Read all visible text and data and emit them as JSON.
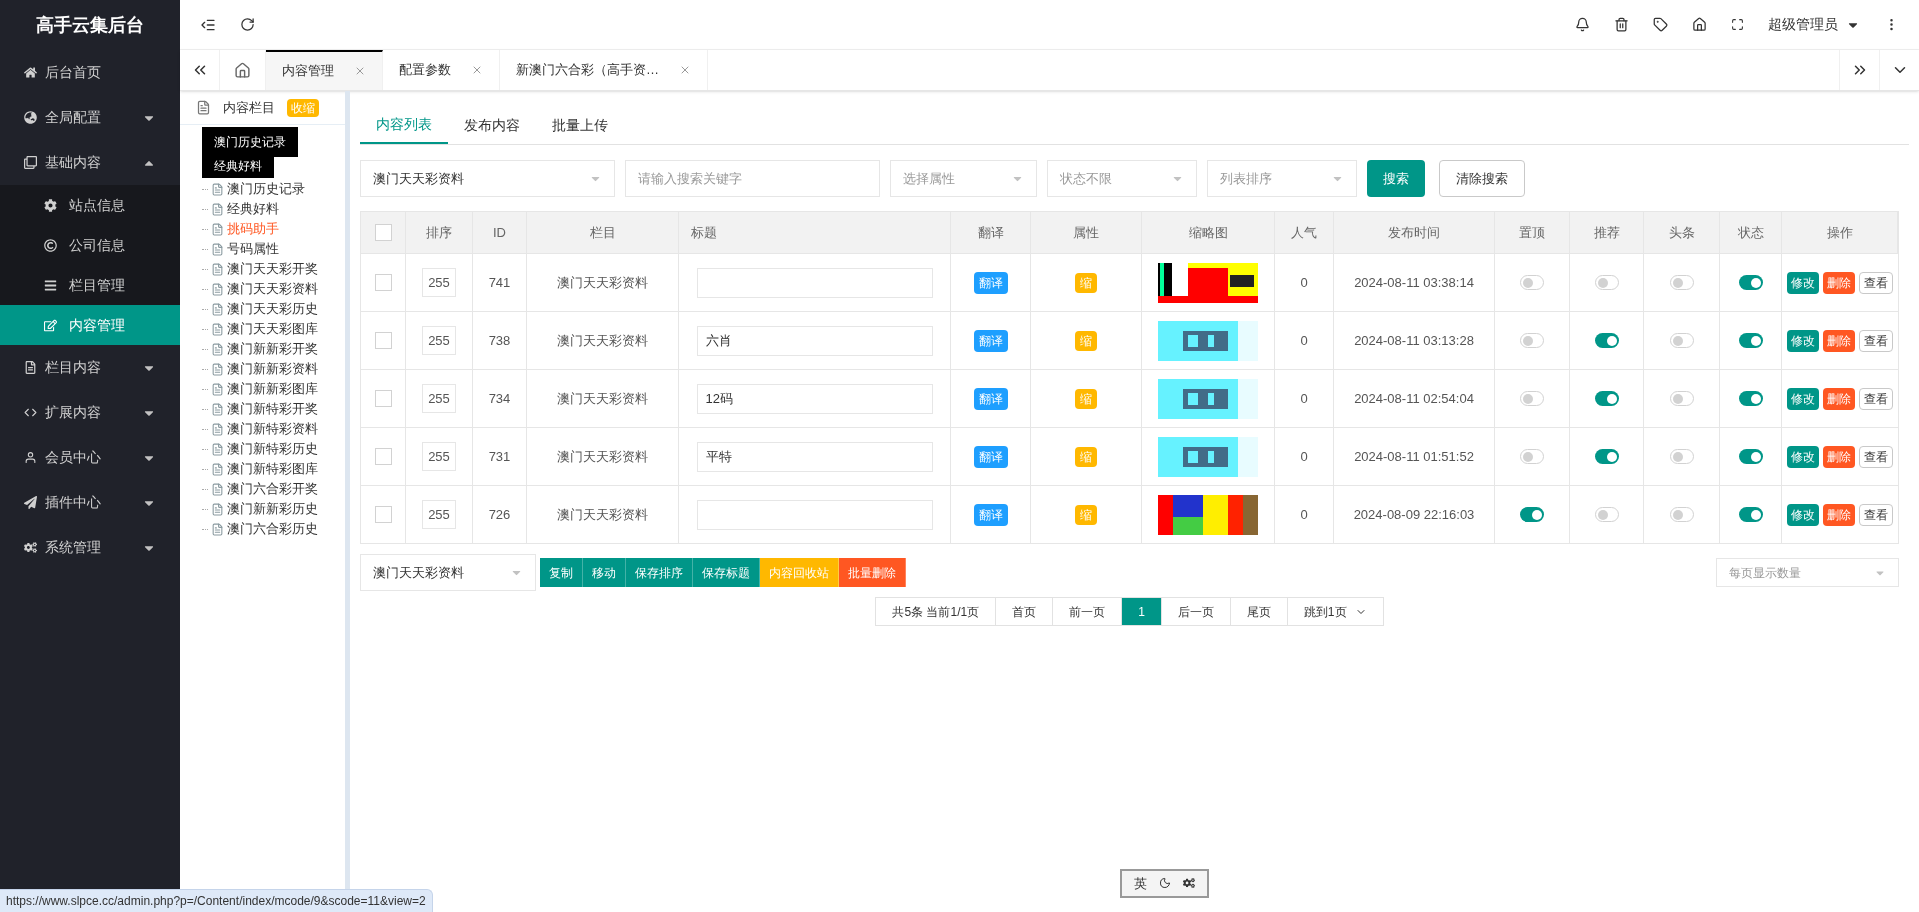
{
  "sidebar": {
    "title": "高手云集后台",
    "items": [
      {
        "label": "后台首页"
      },
      {
        "label": "全局配置",
        "expanded": false
      },
      {
        "label": "基础内容",
        "expanded": true,
        "children": [
          {
            "label": "站点信息",
            "selected": false
          },
          {
            "label": "公司信息",
            "selected": false
          },
          {
            "label": "栏目管理",
            "selected": false
          },
          {
            "label": "内容管理",
            "selected": true
          }
        ]
      },
      {
        "label": "栏目内容",
        "expanded": false
      },
      {
        "label": "扩展内容",
        "expanded": false
      },
      {
        "label": "会员中心",
        "expanded": false
      },
      {
        "label": "插件中心",
        "expanded": false
      },
      {
        "label": "系统管理",
        "expanded": false
      }
    ]
  },
  "header": {
    "user": "超级管理员"
  },
  "tabs": [
    {
      "label": "内容管理",
      "selected": true
    },
    {
      "label": "配置参数",
      "selected": false
    },
    {
      "label": "新澳门六合彩（高手资…",
      "selected": false
    }
  ],
  "tree": {
    "title": "内容栏目",
    "collapse_badge": "收缩",
    "tooltips": [
      "澳门历史记录",
      "经典好料"
    ],
    "items": [
      {
        "label": "澳门历史记录",
        "highlighted": false
      },
      {
        "label": "经典好料",
        "highlighted": false
      },
      {
        "label": "挑码助手",
        "highlighted": true
      },
      {
        "label": "号码属性",
        "highlighted": false
      },
      {
        "label": "澳门天天彩开奖",
        "highlighted": false
      },
      {
        "label": "澳门天天彩资料",
        "highlighted": false
      },
      {
        "label": "澳门天天彩历史",
        "highlighted": false
      },
      {
        "label": "澳门天天彩图库",
        "highlighted": false
      },
      {
        "label": "澳门新新彩开奖",
        "highlighted": false
      },
      {
        "label": "澳门新新彩资料",
        "highlighted": false
      },
      {
        "label": "澳门新新彩图库",
        "highlighted": false
      },
      {
        "label": "澳门新特彩开奖",
        "highlighted": false
      },
      {
        "label": "澳门新特彩资料",
        "highlighted": false
      },
      {
        "label": "澳门新特彩历史",
        "highlighted": false
      },
      {
        "label": "澳门新特彩图库",
        "highlighted": false
      },
      {
        "label": "澳门六合彩开奖",
        "highlighted": false
      },
      {
        "label": "澳门新新彩历史",
        "highlighted": false
      },
      {
        "label": "澳门六合彩历史",
        "highlighted": false
      }
    ]
  },
  "content_tabs": [
    {
      "label": "内容列表",
      "selected": true
    },
    {
      "label": "发布内容",
      "selected": false
    },
    {
      "label": "批量上传",
      "selected": false
    }
  ],
  "filters": {
    "column_select": "澳门天天彩资料",
    "search_placeholder": "请输入搜索关键字",
    "attribute_placeholder": "选择属性",
    "status_placeholder": "状态不限",
    "sort_placeholder": "列表排序",
    "search_button": "搜索",
    "clear_button": "清除搜索"
  },
  "table": {
    "all_checked": false,
    "columns": [
      "排序",
      "ID",
      "栏目",
      "标题",
      "翻译",
      "属性",
      "缩略图",
      "人气",
      "发布时间",
      "置顶",
      "推荐",
      "头条",
      "状态",
      "操作"
    ],
    "rows": [
      {
        "checked": false,
        "sort": "255",
        "id": "741",
        "column": "澳门天天彩资料",
        "title": "",
        "translate": "翻译",
        "attribute": "缩",
        "thumbnail": {
          "kind": "picture"
        },
        "views": "0",
        "time": "2024-08-11 03:38:14",
        "top": false,
        "recommend": false,
        "headline": false,
        "status": true,
        "actions": [
          "修改",
          "删除",
          "查看"
        ]
      },
      {
        "checked": false,
        "sort": "255",
        "id": "738",
        "column": "澳门天天彩资料",
        "title": "六肖",
        "translate": "翻译",
        "attribute": "缩",
        "thumbnail": {
          "kind": "picture"
        },
        "views": "0",
        "time": "2024-08-11 03:13:28",
        "top": false,
        "recommend": true,
        "headline": false,
        "status": true,
        "actions": [
          "修改",
          "删除",
          "查看"
        ]
      },
      {
        "checked": false,
        "sort": "255",
        "id": "734",
        "column": "澳门天天彩资料",
        "title": "12码",
        "translate": "翻译",
        "attribute": "缩",
        "thumbnail": {
          "kind": "picture"
        },
        "views": "0",
        "time": "2024-08-11 02:54:04",
        "top": false,
        "recommend": true,
        "headline": false,
        "status": true,
        "actions": [
          "修改",
          "删除",
          "查看"
        ]
      },
      {
        "checked": false,
        "sort": "255",
        "id": "731",
        "column": "澳门天天彩资料",
        "title": "平特",
        "translate": "翻译",
        "attribute": "缩",
        "thumbnail": {
          "kind": "picture"
        },
        "views": "0",
        "time": "2024-08-11 01:51:52",
        "top": false,
        "recommend": true,
        "headline": false,
        "status": true,
        "actions": [
          "修改",
          "删除",
          "查看"
        ]
      },
      {
        "checked": false,
        "sort": "255",
        "id": "726",
        "column": "澳门天天彩资料",
        "title": "",
        "translate": "翻译",
        "attribute": "缩",
        "thumbnail": {
          "kind": "picture"
        },
        "views": "0",
        "time": "2024-08-09 22:16:03",
        "top": true,
        "recommend": false,
        "headline": false,
        "status": true,
        "actions": [
          "修改",
          "删除",
          "查看"
        ]
      }
    ]
  },
  "batch": {
    "target_select": "澳门天天彩资料",
    "buttons": [
      {
        "label": "复制",
        "kind": "primary"
      },
      {
        "label": "移动",
        "kind": "primary"
      },
      {
        "label": "保存排序",
        "kind": "primary"
      },
      {
        "label": "保存标题",
        "kind": "primary"
      },
      {
        "label": "内容回收站",
        "kind": "warning"
      },
      {
        "label": "批量删除",
        "kind": "danger"
      }
    ],
    "page_size_placeholder": "每页显示数量"
  },
  "pagination": {
    "summary": "共5条 当前1/1页",
    "pages": [
      {
        "label": "首页",
        "selected": false
      },
      {
        "label": "前一页",
        "selected": false
      },
      {
        "label": "1",
        "selected": true
      },
      {
        "label": "后一页",
        "selected": false
      },
      {
        "label": "尾页",
        "selected": false
      }
    ],
    "jump": "跳到1页"
  },
  "input_method": {
    "label": "英"
  },
  "status_url": "https://www.slpce.cc/admin.php?p=/Content/index/mcode/9&scode=11&view=2"
}
